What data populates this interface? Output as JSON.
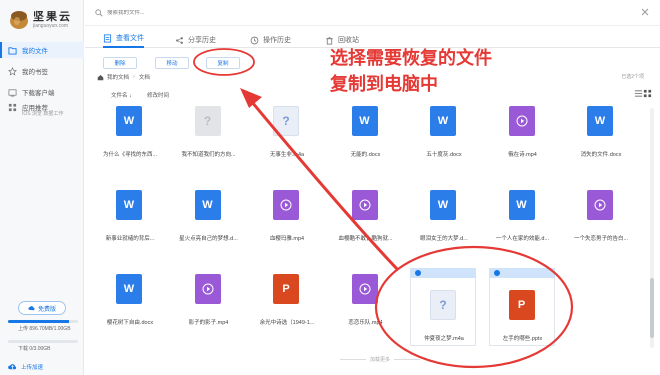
{
  "app": {
    "logo_name": "坚果云",
    "logo_domain": "jianguoyun.com",
    "brand_color": "#1677e6",
    "annotation_color": "#e53935"
  },
  "sidebar": {
    "items": [
      {
        "label": "我的文件",
        "icon": "folder-icon",
        "active": true
      },
      {
        "label": "我的书签",
        "icon": "star-icon",
        "active": false
      },
      {
        "label": "下载客户端",
        "icon": "download-icon",
        "active": false
      },
      {
        "label": "应用推荐",
        "icon": "apps-icon",
        "active": false
      }
    ],
    "apps_sub": "IOS 浏览 数据工作",
    "vip_label": "免费版",
    "upload_quota": "上传 896.70MB/1.00GB",
    "upload_fraction": 0.876,
    "download_quota": "下载 0/3.00GB",
    "download_fraction": 0.0,
    "upload_link": "上传加速"
  },
  "topbar": {
    "search_placeholder": "搜索我的文件..."
  },
  "tabs": [
    {
      "label": "查看文件",
      "icon": "file-view-icon",
      "active": true
    },
    {
      "label": "分享历史",
      "icon": "share-icon",
      "active": false
    },
    {
      "label": "操作历史",
      "icon": "history-icon",
      "active": false
    },
    {
      "label": "回收站",
      "icon": "trash-icon",
      "active": false
    }
  ],
  "actions": {
    "delete": "删除",
    "move": "移动",
    "copy": "复制"
  },
  "breadcrumb": {
    "root": "我的文档",
    "current": "文档"
  },
  "selected_count": "已选2个项",
  "sortbar": {
    "name_col": "文件名 ↓",
    "time_col": "修改时间"
  },
  "files": [
    {
      "name": "为什么《寻找的东西...",
      "type": "word",
      "glyph": "W"
    },
    {
      "name": "我不知道我们的方向...",
      "type": "unknown",
      "glyph": "?"
    },
    {
      "name": "无事生非.m4a",
      "type": "audio",
      "glyph": "?"
    },
    {
      "name": "无能的.docx",
      "type": "word",
      "glyph": "W"
    },
    {
      "name": "五十度灰.docx",
      "type": "word",
      "glyph": "W"
    },
    {
      "name": "俄在诗.mp4",
      "type": "video",
      "glyph": "▶"
    },
    {
      "name": "消失的文件.docx",
      "type": "word",
      "glyph": "W"
    },
    {
      "name": "新事业就绪的背后...",
      "type": "word",
      "glyph": "W"
    },
    {
      "name": "星火点亮自己的梦想.d...",
      "type": "word",
      "glyph": "W"
    },
    {
      "name": "血樱玛雅.mp4",
      "type": "video",
      "glyph": "▶"
    },
    {
      "name": "血樱酷不敢，酷狗就...",
      "type": "video",
      "glyph": "▶"
    },
    {
      "name": "眼泪女王的大梦.d...",
      "type": "word",
      "glyph": "W"
    },
    {
      "name": "一个人在家的效能.d...",
      "type": "word",
      "glyph": "W"
    },
    {
      "name": "一个失恋男子的告白...",
      "type": "video",
      "glyph": "▶"
    },
    {
      "name": "樱花树下自由.docx",
      "type": "word",
      "glyph": "W"
    },
    {
      "name": "影子的影子.mp4",
      "type": "video",
      "glyph": "▶"
    },
    {
      "name": "余光中诗选（1949-1...",
      "type": "ppt",
      "glyph": "P"
    },
    {
      "name": "恋恋乐队.mp4",
      "type": "video",
      "glyph": "▶"
    },
    {
      "name": "仲夏夜之梦.m4a",
      "type": "audio",
      "glyph": "?",
      "selected": true
    },
    {
      "name": "左手的哪些.pptx",
      "type": "ppt",
      "glyph": "P",
      "selected": true
    }
  ],
  "load_more": "加载更多",
  "annotation": {
    "callout_line1": "选择需要恢复的文件",
    "callout_line2": "复制到电脑中"
  }
}
